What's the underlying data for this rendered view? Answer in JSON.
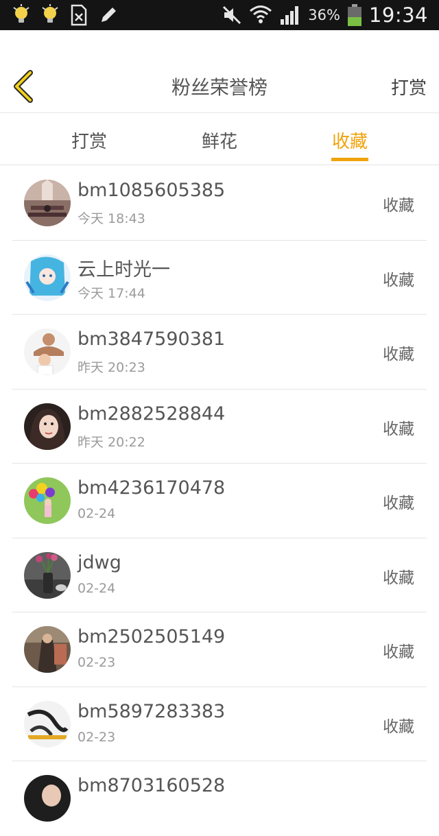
{
  "status_bar": {
    "battery_percent": "36%",
    "time": "19:34",
    "icons": [
      "notification-bulb-icon",
      "notification-bulb-icon",
      "sim-card-icon",
      "pen-icon",
      "mute-icon",
      "wifi-icon",
      "signal-icon",
      "battery-icon"
    ]
  },
  "header": {
    "title": "粉丝荣誉榜",
    "action_label": "打赏",
    "back_icon": "back-chevron-icon",
    "accent_color": "#f0a30a"
  },
  "tabs": [
    {
      "label": "打赏",
      "active": false
    },
    {
      "label": "鲜花",
      "active": false
    },
    {
      "label": "收藏",
      "active": true
    }
  ],
  "rows": [
    {
      "name": "bm1085605385",
      "time": "今天 18:43",
      "action": "收藏"
    },
    {
      "name": "云上时光一",
      "time": "今天 17:44",
      "action": "收藏"
    },
    {
      "name": "bm3847590381",
      "time": "昨天 20:23",
      "action": "收藏"
    },
    {
      "name": "bm2882528844",
      "time": "昨天 20:22",
      "action": "收藏"
    },
    {
      "name": "bm4236170478",
      "time": "02-24",
      "action": "收藏"
    },
    {
      "name": "jdwg",
      "time": "02-24",
      "action": "收藏"
    },
    {
      "name": "bm2502505149",
      "time": "02-23",
      "action": "收藏"
    },
    {
      "name": "bm5897283383",
      "time": "02-23",
      "action": "收藏"
    },
    {
      "name": "bm8703160528",
      "time": "",
      "action": ""
    }
  ]
}
